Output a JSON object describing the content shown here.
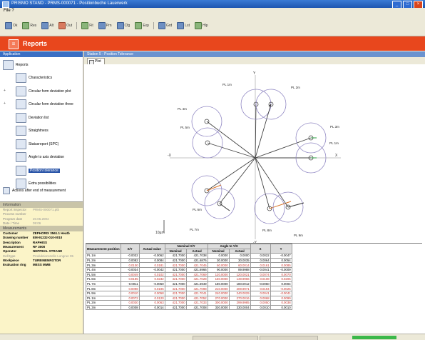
{
  "window": {
    "title": "PRISMO STAND - PRMS-000071 - Positionbuche Lauerwerk",
    "min": "_",
    "max": "□",
    "close": "×"
  },
  "menu": {
    "file": "File  ?"
  },
  "toolbar": [
    {
      "label": "Ok",
      "icon": "ok-icon"
    },
    {
      "label": "Res",
      "icon": "results-icon"
    },
    {
      "label": "Alt",
      "icon": "alternate-icon"
    },
    {
      "label": "Out",
      "icon": "output-icon"
    },
    {
      "label": "Fit",
      "icon": "fit-icon"
    },
    {
      "label": "Prn",
      "icon": "print-icon"
    },
    {
      "label": "Cfg",
      "icon": "settings-icon"
    },
    {
      "label": "Exp",
      "icon": "export-icon"
    },
    {
      "label": "Grd",
      "icon": "grid-icon"
    },
    {
      "label": "Lst",
      "icon": "list-icon"
    },
    {
      "label": "Hlp",
      "icon": "help-icon"
    }
  ],
  "banner": {
    "title": "Reports",
    "icon_glyph": "≡"
  },
  "sidebar": {
    "header": "Application",
    "root": "Reports",
    "items": [
      {
        "label": "Characteristics",
        "icon": "characteristics-icon",
        "expandable": false,
        "selected": false
      },
      {
        "label": "Circular form deviation plot",
        "icon": "circle-form-icon",
        "expandable": true,
        "selected": false
      },
      {
        "label": "Circular form deviation three",
        "icon": "circle-form-3-icon",
        "expandable": true,
        "selected": false
      },
      {
        "label": "Deviation list",
        "icon": "deviation-list-icon",
        "expandable": false,
        "selected": false
      },
      {
        "label": "Straightness",
        "icon": "straightness-icon",
        "expandable": false,
        "selected": false
      },
      {
        "label": "Statusreport (SPC)",
        "icon": "spc-icon",
        "expandable": false,
        "selected": false
      },
      {
        "label": "Angle to axis deviation",
        "icon": "angle-icon",
        "expandable": false,
        "selected": false
      },
      {
        "label": "Position tolerance",
        "icon": "position-icon",
        "expandable": false,
        "selected": true
      },
      {
        "label": "Extra possibilities",
        "icon": "extra-icon",
        "expandable": false,
        "selected": false
      }
    ],
    "footer_action": "Actions after end of measurement"
  },
  "properties": {
    "section1": "Information",
    "rows1": [
      {
        "k": "Report inspector",
        "v": "PRMS-000071.ptb"
      },
      {
        "k": "Process number",
        "v": ""
      },
      {
        "k": "Program date",
        "v": "20.06.2004"
      },
      {
        "k": "Date / Time",
        "v": "09:06"
      }
    ],
    "section2": "Measurements",
    "rows2": [
      {
        "k": "Customer",
        "v": "ZEPHORIX 3561.1 Heatb",
        "bold": true
      },
      {
        "k": "Drawing number",
        "v": "EM-91232-010-0010",
        "bold": true
      },
      {
        "k": "Description",
        "v": "RAPHISS",
        "bold": true
      },
      {
        "k": "Measurement",
        "v": "RF 3000",
        "bold": true
      },
      {
        "k": "Operator",
        "v": "NEPPBAL STRAND",
        "bold": true
      },
      {
        "k": "Cell type",
        "v": "Produktionszelle Longrun 05",
        "bold": false
      },
      {
        "k": "Workpiece",
        "v": "TURBINENROTOR",
        "bold": true
      },
      {
        "k": "Evaluation ring",
        "v": "MESS MMB",
        "bold": true
      }
    ]
  },
  "main": {
    "header": "Station 5 - Position Tolerance",
    "tab": "Plot",
    "plot": {
      "axes": {
        "top": "Y",
        "right": "X",
        "left": "-X",
        "bottom": "-Y"
      },
      "scale_label": "10µm",
      "points": [
        {
          "label": "PL 1m",
          "color": "#333333"
        },
        {
          "label": "PL 2m",
          "color": "#333333"
        },
        {
          "label": "PL 3m",
          "color": "#2ea043"
        },
        {
          "label": "PL 1m",
          "color": "#2ea043"
        },
        {
          "label": "PL 4m",
          "color": "#333333"
        },
        {
          "label": "PL 5m",
          "color": "#333333"
        },
        {
          "label": "PL 6m",
          "color": "#d9742a"
        },
        {
          "label": "PL 7m",
          "color": "#333333"
        },
        {
          "label": "PL 8m",
          "color": "#d9742a"
        },
        {
          "label": "PL 9m",
          "color": "#333333"
        }
      ]
    },
    "table": {
      "headers": [
        "Measurement position",
        "X/Y",
        "Actual value",
        "Nominal X/Y",
        "Angle to Y/X",
        "X",
        "Y"
      ],
      "subheaders": [
        "",
        "",
        "",
        "Nominal",
        "Actual",
        "Nominal",
        "Actual",
        "",
        ""
      ],
      "rows": [
        {
          "c": [
            "PL 1m",
            "-0.0032",
            "-0.0062",
            "421.7000",
            "421.7038",
            "0.0000",
            "0.0000",
            "0.0022",
            "-0.0047"
          ],
          "red": false
        },
        {
          "c": [
            "PL 2m",
            "0.0082",
            "0.0084",
            "421.7000",
            "421.6876",
            "30.0000",
            "30.0035",
            "0.0064",
            "0.0054"
          ],
          "red": false
        },
        {
          "c": [
            "PL 3m",
            "0.0100",
            "0.0181",
            "421.7000",
            "421.7045",
            "60.0000",
            "60.0014",
            "0.0161",
            "0.0085"
          ],
          "red": true
        },
        {
          "c": [
            "PL 4m",
            "-0.0034",
            "-0.0042",
            "421.7000",
            "421.6966",
            "90.0000",
            "89.9988",
            "-0.0041",
            "-0.0009"
          ],
          "red": false
        },
        {
          "c": [
            "PL 5m",
            "0.0049",
            "0.0102",
            "421.7000",
            "421.7069",
            "120.0000",
            "120.0021",
            "0.0074",
            "0.0070"
          ],
          "red": true
        },
        {
          "c": [
            "PL 6m",
            "0.0185",
            "0.0232",
            "421.7000",
            "421.7028",
            "150.0000",
            "149.9966",
            "0.0108",
            "0.0205"
          ],
          "red": true
        },
        {
          "c": [
            "PL 7m",
            "-0.0011",
            "-0.0050",
            "421.7000",
            "421.6949",
            "180.0000",
            "180.0012",
            "-0.0050",
            "0.0004"
          ],
          "red": false
        },
        {
          "c": [
            "PL 8m",
            "0.0098",
            "0.0196",
            "421.7000",
            "421.7098",
            "210.0000",
            "209.9971",
            "0.0194",
            "-0.0025"
          ],
          "red": true
        },
        {
          "c": [
            "PL 9m",
            "0.0010",
            "0.0058",
            "421.7000",
            "421.7041",
            "240.0000",
            "240.0029",
            "0.0041",
            "-0.0041"
          ],
          "red": true
        },
        {
          "c": [
            "PL 1m",
            "0.0072",
            "0.0120",
            "421.7000",
            "421.7052",
            "270.0000",
            "270.0016",
            "0.0068",
            "0.0099"
          ],
          "red": true
        },
        {
          "c": [
            "PL 2m",
            "0.0030",
            "0.0063",
            "421.7000",
            "421.7033",
            "300.0000",
            "299.9985",
            "0.0050",
            "0.0038"
          ],
          "red": true
        },
        {
          "c": [
            "PL 3m",
            "0.0008",
            "0.0014",
            "421.7000",
            "421.7008",
            "330.0000",
            "330.0004",
            "0.0010",
            "0.0010"
          ],
          "red": false
        }
      ]
    }
  }
}
